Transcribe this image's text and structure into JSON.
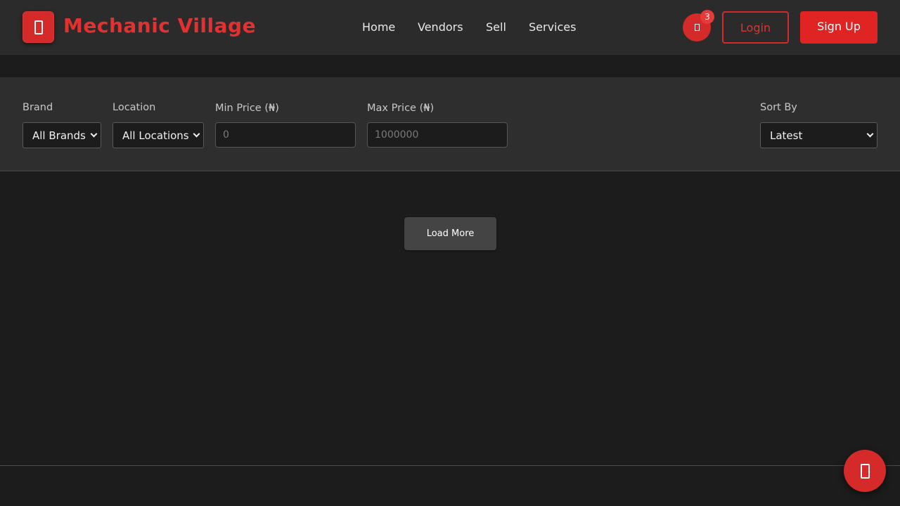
{
  "header": {
    "brand": "Mechanic Village",
    "logo_icon": "wrench-icon",
    "nav": [
      {
        "label": "Home"
      },
      {
        "label": "Vendors"
      },
      {
        "label": "Sell"
      },
      {
        "label": "Services"
      }
    ],
    "cart_icon": "cart-icon",
    "cart_count": "3",
    "login_label": "Login",
    "signup_label": "Sign Up",
    "accent_color": "#e02424"
  },
  "filters": {
    "brand": {
      "label": "Brand",
      "value": "All Brands"
    },
    "location": {
      "label": "Location",
      "value": "All Locations"
    },
    "min_price": {
      "label": "Min Price (₦)",
      "placeholder": "0"
    },
    "max_price": {
      "label": "Max Price (₦)",
      "placeholder": "1000000"
    },
    "sort": {
      "label": "Sort By",
      "value": "Latest"
    }
  },
  "main": {
    "load_more_label": "Load More"
  },
  "fab": {
    "icon": "chat-icon"
  }
}
